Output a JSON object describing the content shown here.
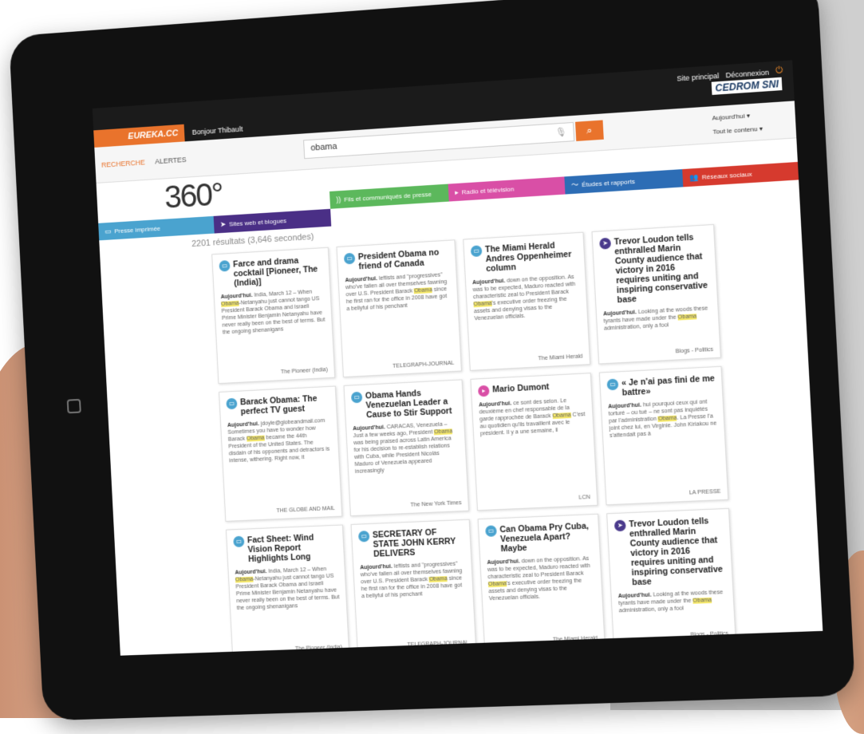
{
  "topbar": {
    "site_link": "Site principal",
    "logout": "Déconnexion",
    "brand": "EUREKA.CC",
    "greeting": "Bonjour Thibault",
    "company": "CEDROM SNI"
  },
  "nav": {
    "recherche": "RECHERCHE",
    "alertes": "ALERTES"
  },
  "search": {
    "query": "obama"
  },
  "filters": {
    "date": "Aujourd'hui ▾",
    "content": "Tout le contenu ▾"
  },
  "logo": "360°",
  "categories": [
    {
      "label": "Presse imprimée",
      "glyph": "▭",
      "color": "#4aa3cf"
    },
    {
      "label": "Sites web et blogues",
      "glyph": "➤",
      "color": "#4a2f86"
    },
    {
      "label": "Fils et communiqués de presse",
      "glyph": "))",
      "color": "#5cb85c"
    },
    {
      "label": "Radio et télévision",
      "glyph": "▸",
      "color": "#d94fa6"
    },
    {
      "label": "Études et rapports",
      "glyph": "〜",
      "color": "#2d6db5"
    },
    {
      "label": "Réseaux sociaux",
      "glyph": "👥",
      "color": "#d63a2e"
    }
  ],
  "results": {
    "count_text": "2201 résultats (3,646 secondes)"
  },
  "cards": [
    {
      "title": "Farce and drama cocktail [Pioneer, The (India)]",
      "lead": "Aujourd'hui.",
      "pre": " India, March 12 – When ",
      "hl": "Obama",
      "post": "-Netanyahu just cannot tango US President Barack Obama and Israeli Prime Minister Benjamin Netanyahu have never really been on the best of terms. But the ongoing shenanigans",
      "source": "The Pioneer (India)",
      "type": "press"
    },
    {
      "title": "President Obama no friend of Canada",
      "lead": "Aujourd'hui.",
      "pre": " leftists and \"progressives\" who've fallen all over themselves fawning over U.S. President Barack ",
      "hl": "Obama",
      "post": " since he first ran for the office in 2008 have got a bellyful of his penchant",
      "source": "TELEGRAPH-JOURNAL",
      "type": "press"
    },
    {
      "title": "The Miami Herald Andres Oppenheimer column",
      "lead": "Aujourd'hui.",
      "pre": " down on the opposition. As was to be expected, Maduro reacted with characteristic zeal to President Barack ",
      "hl": "Obama",
      "post": "'s executive order freezing the assets and denying visas to the Venezuelan officials.",
      "source": "The Miami Herald",
      "type": "press"
    },
    {
      "title": "Trevor Loudon tells enthralled Marin County audience that victory in 2016 requires uniting and inspiring conservative base",
      "lead": "Aujourd'hui.",
      "pre": " Looking at the woods these tyrants have made under the ",
      "hl": "Obama",
      "post": " administration, only a fool",
      "source": "Blogs - Politics",
      "type": "web"
    },
    {
      "title": "Barack Obama: The perfect TV guest",
      "lead": "Aujourd'hui.",
      "pre": " jdoyle@globeandmail.com Sometimes you have to wonder how Barack ",
      "hl": "Obama",
      "post": " became the 44th President of the United States. The disdain of his opponents and detractors is intense, withering. Right now, it",
      "source": "THE GLOBE AND MAIL",
      "type": "press"
    },
    {
      "title": "Obama Hands Venezuelan Leader a Cause to Stir Support",
      "lead": "Aujourd'hui.",
      "pre": " CARACAS, Venezuela – Just a few weeks ago, President ",
      "hl": "Obama",
      "post": " was being praised across Latin America for his decision to re-establish relations with Cuba, while President Nicolás Maduro of Venezuela appeared increasingly",
      "source": "The New York Times",
      "type": "press"
    },
    {
      "title": "Mario Dumont",
      "lead": "Aujourd'hui.",
      "pre": " ce sont des selon. Le deuxième en chef responsable de la garde rapprochée de Barack ",
      "hl": "Obama",
      "post": " C'est au quotidien qu'ils travaillent avec le président. Il y a une semaine, il",
      "source": "LCN",
      "type": "radio"
    },
    {
      "title": "« Je n'ai pas fini de me battre»",
      "lead": "Aujourd'hui.",
      "pre": " hui pourquoi ceux qui ont torturé – ou tué – ne sont pas inquiétés par l'administration ",
      "hl": "Obama",
      "post": ". La Presse l'a joint chez lui, en Virginie. John Kiriakou ne s'attendait pas à",
      "source": "LA PRESSE",
      "type": "press"
    },
    {
      "title": "Fact Sheet: Wind Vision Report Highlights Long",
      "lead": "Aujourd'hui.",
      "pre": " India, March 12 – When ",
      "hl": "Obama",
      "post": "-Netanyahu just cannot tango US President Barack Obama and Israeli Prime Minister Benjamin Netanyahu have never really been on the best of terms. But the ongoing shenanigans",
      "source": "The Pioneer (India)",
      "type": "press"
    },
    {
      "title": "SECRETARY OF STATE JOHN KERRY DELIVERS",
      "lead": "Aujourd'hui.",
      "pre": " leftists and \"progressives\" who've fallen all over themselves fawning over U.S. President Barack ",
      "hl": "Obama",
      "post": " since he first ran for the office in 2008 have got a bellyful of his penchant",
      "source": "TELEGRAPH-JOURNAL",
      "type": "press"
    },
    {
      "title": "Can Obama Pry Cuba, Venezuela Apart? Maybe",
      "lead": "Aujourd'hui.",
      "pre": " down on the opposition. As was to be expected, Maduro reacted with characteristic zeal to President Barack ",
      "hl": "Obama",
      "post": "'s executive order freezing the assets and denying visas to the Venezuelan officials.",
      "source": "The Miami Herald",
      "type": "press"
    },
    {
      "title": "Trevor Loudon tells enthralled Marin County audience that victory in 2016 requires uniting and inspiring conservative base",
      "lead": "Aujourd'hui.",
      "pre": " Looking at the woods these tyrants have made under the ",
      "hl": "Obama",
      "post": " administration, only a fool",
      "source": "Blogs - Politics",
      "type": "web"
    }
  ]
}
